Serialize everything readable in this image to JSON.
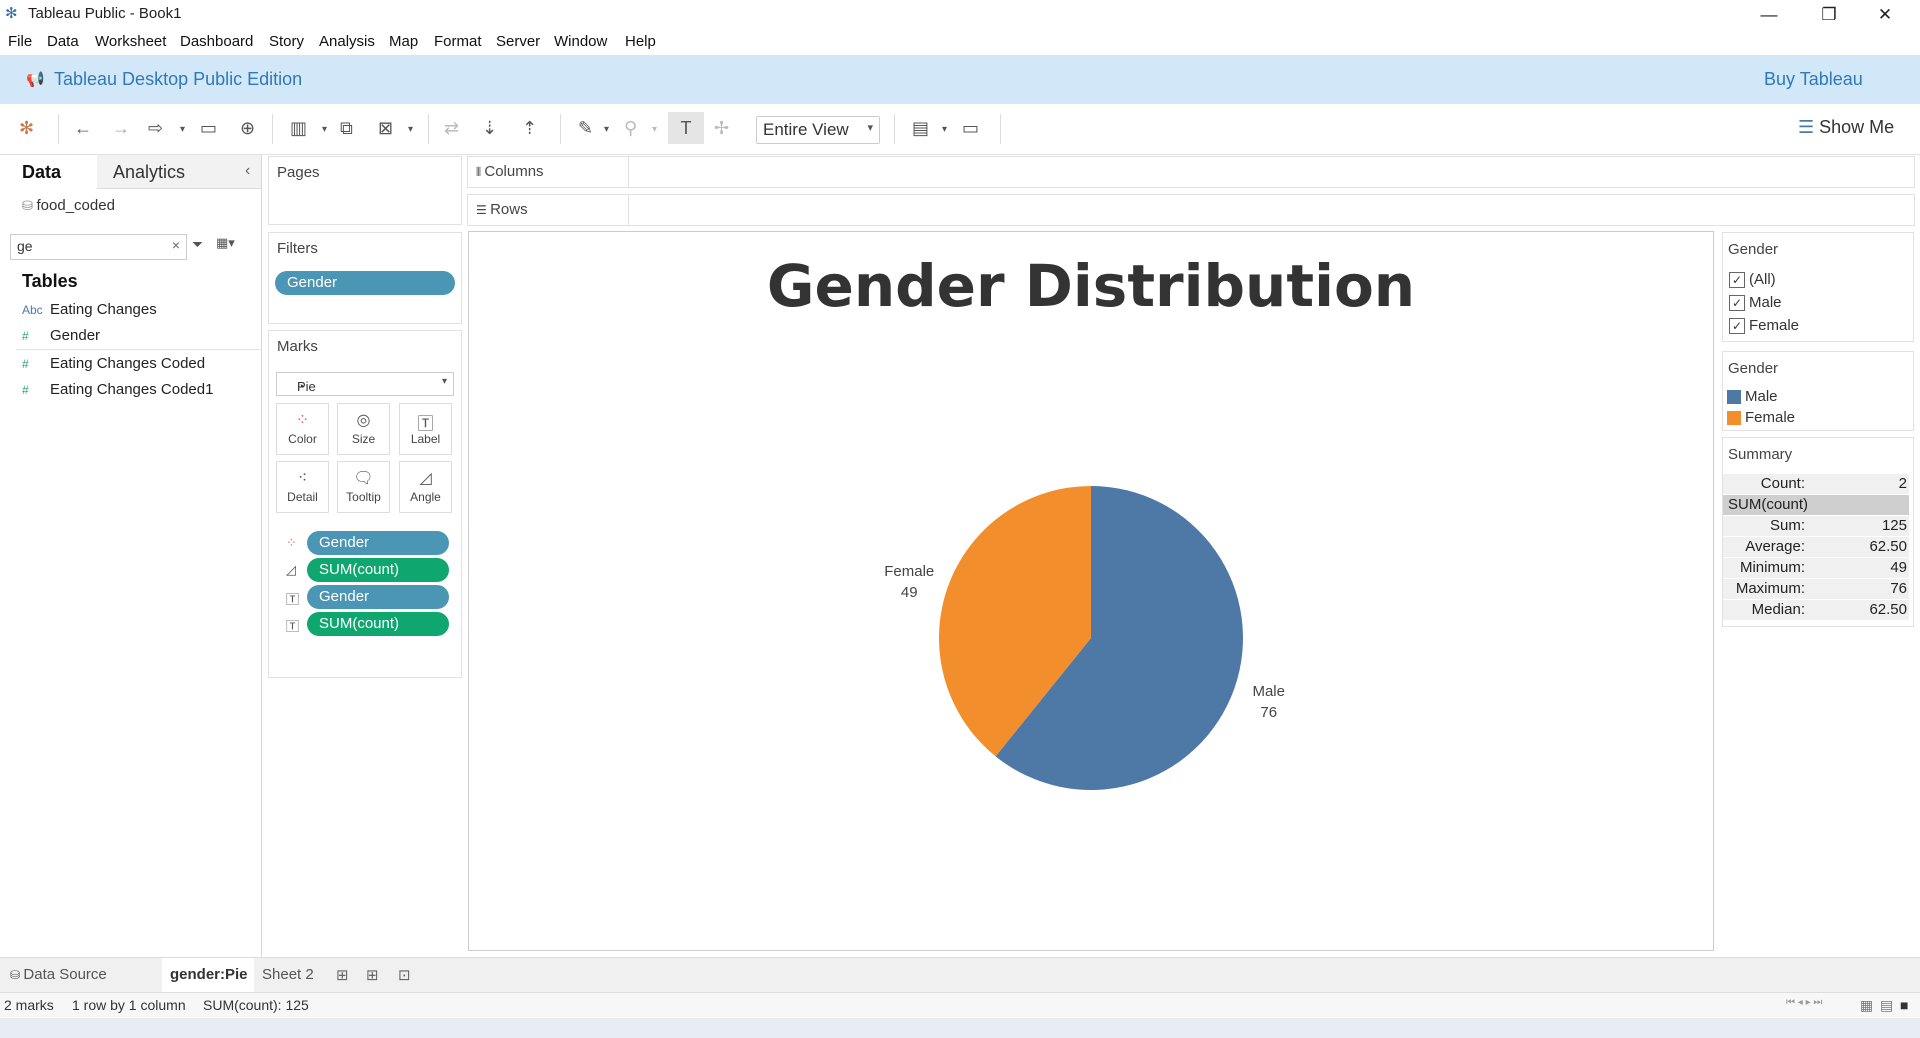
{
  "window": {
    "title": "Tableau Public - Book1"
  },
  "menu": [
    "File",
    "Data",
    "Worksheet",
    "Dashboard",
    "Story",
    "Analysis",
    "Map",
    "Format",
    "Server",
    "Window",
    "Help"
  ],
  "banner": {
    "edition": "Tableau Desktop Public Edition",
    "buy": "Buy Tableau"
  },
  "toolbar": {
    "view_mode": "Entire View",
    "show_me": "Show Me"
  },
  "datapane": {
    "tabs": [
      "Data",
      "Analytics"
    ],
    "datasource": "food_coded",
    "search_value": "ge",
    "tables_heading": "Tables",
    "fields": [
      {
        "type": "Abc",
        "name": "Eating Changes"
      },
      {
        "type": "#",
        "name": "Gender"
      },
      {
        "type": "#",
        "name": "Eating Changes Coded"
      },
      {
        "type": "#",
        "name": "Eating Changes Coded1"
      }
    ]
  },
  "shelves": {
    "pages": "Pages",
    "filters": "Filters",
    "filter_pill": "Gender",
    "columns": "Columns",
    "rows": "Rows"
  },
  "marks": {
    "heading": "Marks",
    "type": "Pie",
    "buttons": [
      "Color",
      "Size",
      "Label",
      "Detail",
      "Tooltip",
      "Angle"
    ],
    "pills": [
      {
        "icon": "color",
        "label": "Gender",
        "kind": "dimension"
      },
      {
        "icon": "angle",
        "label": "SUM(count)",
        "kind": "measure"
      },
      {
        "icon": "label",
        "label": "Gender",
        "kind": "dimension"
      },
      {
        "icon": "label",
        "label": "SUM(count)",
        "kind": "measure"
      }
    ]
  },
  "chart_data": {
    "type": "pie",
    "title": "Gender Distribution",
    "categories": [
      "Male",
      "Female"
    ],
    "values": [
      76,
      49
    ],
    "colors": [
      "#4e79a7",
      "#f28e2b"
    ]
  },
  "filter_card": {
    "title": "Gender",
    "options": [
      "(All)",
      "Male",
      "Female"
    ]
  },
  "legend_card": {
    "title": "Gender",
    "items": [
      {
        "label": "Male",
        "color": "#4e79a7"
      },
      {
        "label": "Female",
        "color": "#f28e2b"
      }
    ]
  },
  "summary_card": {
    "title": "Summary",
    "count_label": "Count:",
    "count": "2",
    "field": "SUM(count)",
    "rows": [
      {
        "k": "Sum:",
        "v": "125"
      },
      {
        "k": "Average:",
        "v": "62.50"
      },
      {
        "k": "Minimum:",
        "v": "49"
      },
      {
        "k": "Maximum:",
        "v": "76"
      },
      {
        "k": "Median:",
        "v": "62.50"
      }
    ]
  },
  "sheet_tabs": {
    "datasource": "Data Source",
    "tabs": [
      "gender:Pie",
      "Sheet 2"
    ]
  },
  "status": {
    "marks": "2 marks",
    "dims": "1 row by 1 column",
    "sum": "SUM(count): 125"
  }
}
